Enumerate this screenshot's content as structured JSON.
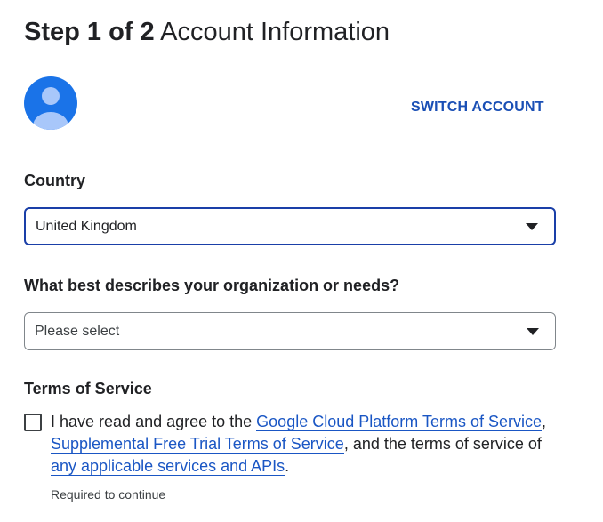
{
  "header": {
    "step": "Step 1 of 2",
    "title": "Account Information"
  },
  "account": {
    "avatar_icon": "account-avatar-icon",
    "switch_label": "SWITCH ACCOUNT"
  },
  "country": {
    "label": "Country",
    "value": "United Kingdom"
  },
  "organization": {
    "label": "What best describes your organization or needs?",
    "placeholder": "Please select"
  },
  "terms": {
    "heading": "Terms of Service",
    "checked": false,
    "text_start": "I have read and agree to the ",
    "link_gcp": "Google Cloud Platform Terms of Service",
    "sep": ", ",
    "link_trial": "Supplemental Free Trial Terms of Service",
    "text_mid": ", and the terms of service of ",
    "link_services": "any applicable services and APIs",
    "text_end": ".",
    "required": "Required to continue"
  },
  "colors": {
    "primary_link": "#1a56c4",
    "focus_border": "#1a3fa8",
    "avatar_bg": "#1a73e8"
  }
}
